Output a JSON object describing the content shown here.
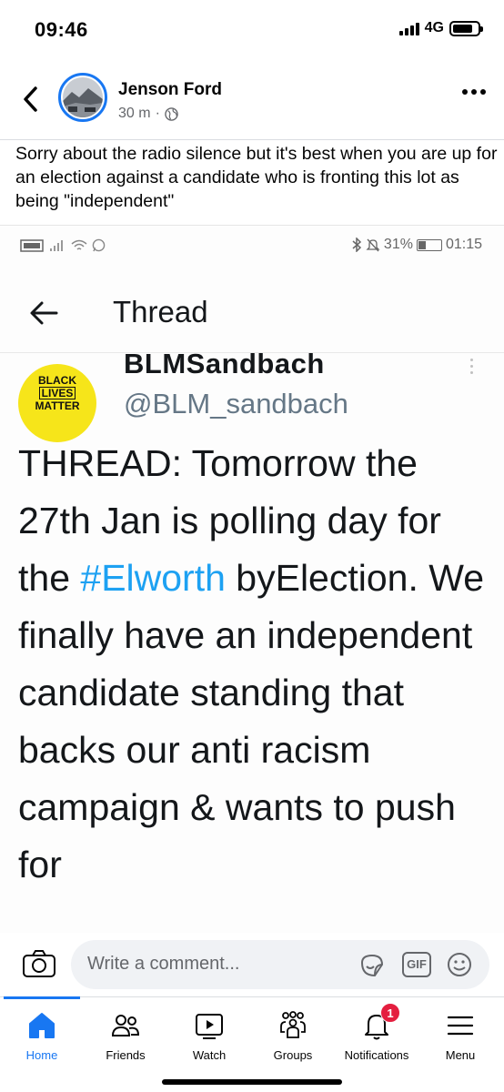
{
  "status_bar": {
    "time": "09:46",
    "network": "4G"
  },
  "post": {
    "author": "Jenson Ford",
    "time": "30 m",
    "text": "Sorry about the radio silence but it's best when you are up for an election against a candidate who is fronting this lot as being \"independent\""
  },
  "embedded_screenshot": {
    "android_status": {
      "battery": "31%",
      "time": "01:15"
    },
    "thread_title": "Thread",
    "tweet": {
      "avatar_text": {
        "line1": "BLACK",
        "line2": "LIVES",
        "line3": "MATTER"
      },
      "name": "BLMSandbach",
      "handle": "@BLM_sandbach",
      "body_before": "THREAD: Tomorrow the 27th Jan is polling day for the ",
      "hashtag": "#Elworth",
      "body_after": " byElection. We finally have an independent candidate standing that backs our anti racism campaign & wants to push for"
    }
  },
  "comment_bar": {
    "placeholder": "Write a comment...",
    "gif_label": "GIF"
  },
  "bottom_nav": {
    "home": "Home",
    "friends": "Friends",
    "watch": "Watch",
    "groups": "Groups",
    "notifications": "Notifications",
    "notifications_badge": "1",
    "menu": "Menu"
  },
  "colors": {
    "accent": "#1877f2",
    "badge": "#e41e3f",
    "hashtag": "#1da1f2",
    "blm_yellow": "#f6e51a"
  }
}
